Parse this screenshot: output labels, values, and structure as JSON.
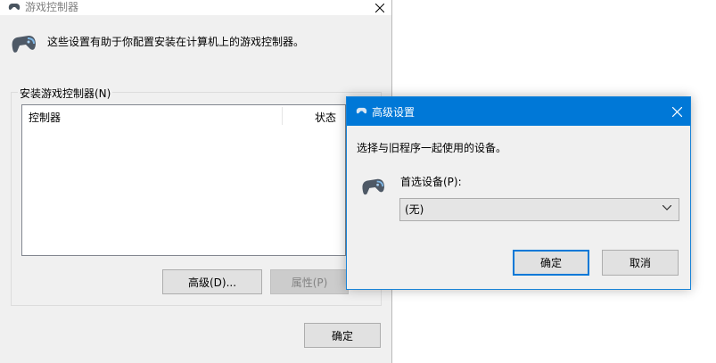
{
  "main_window": {
    "title": "游戏控制器",
    "description": "这些设置有助于你配置安装在计算机上的游戏控制器。",
    "group_label": "安装游戏控制器(N)",
    "columns": {
      "controller": "控制器",
      "status": "状态"
    },
    "buttons": {
      "advanced": "高级(D)...",
      "properties": "属性(P)",
      "ok": "确定"
    },
    "icons": {
      "title": "gamepad-icon",
      "header": "gamepad-icon",
      "close": "close-icon"
    }
  },
  "dialog": {
    "title": "高级设置",
    "description": "选择与旧程序一起使用的设备。",
    "preferred_device_label": "首选设备(P):",
    "preferred_device_value": "(无)",
    "buttons": {
      "ok": "确定",
      "cancel": "取消"
    },
    "icons": {
      "title": "gamepad-icon",
      "device": "gamepad-icon",
      "close": "close-icon",
      "dropdown": "chevron-down-icon"
    }
  },
  "colors": {
    "accent": "#0078d7",
    "window_bg": "#f0f0f0",
    "disabled_text": "#838383"
  }
}
